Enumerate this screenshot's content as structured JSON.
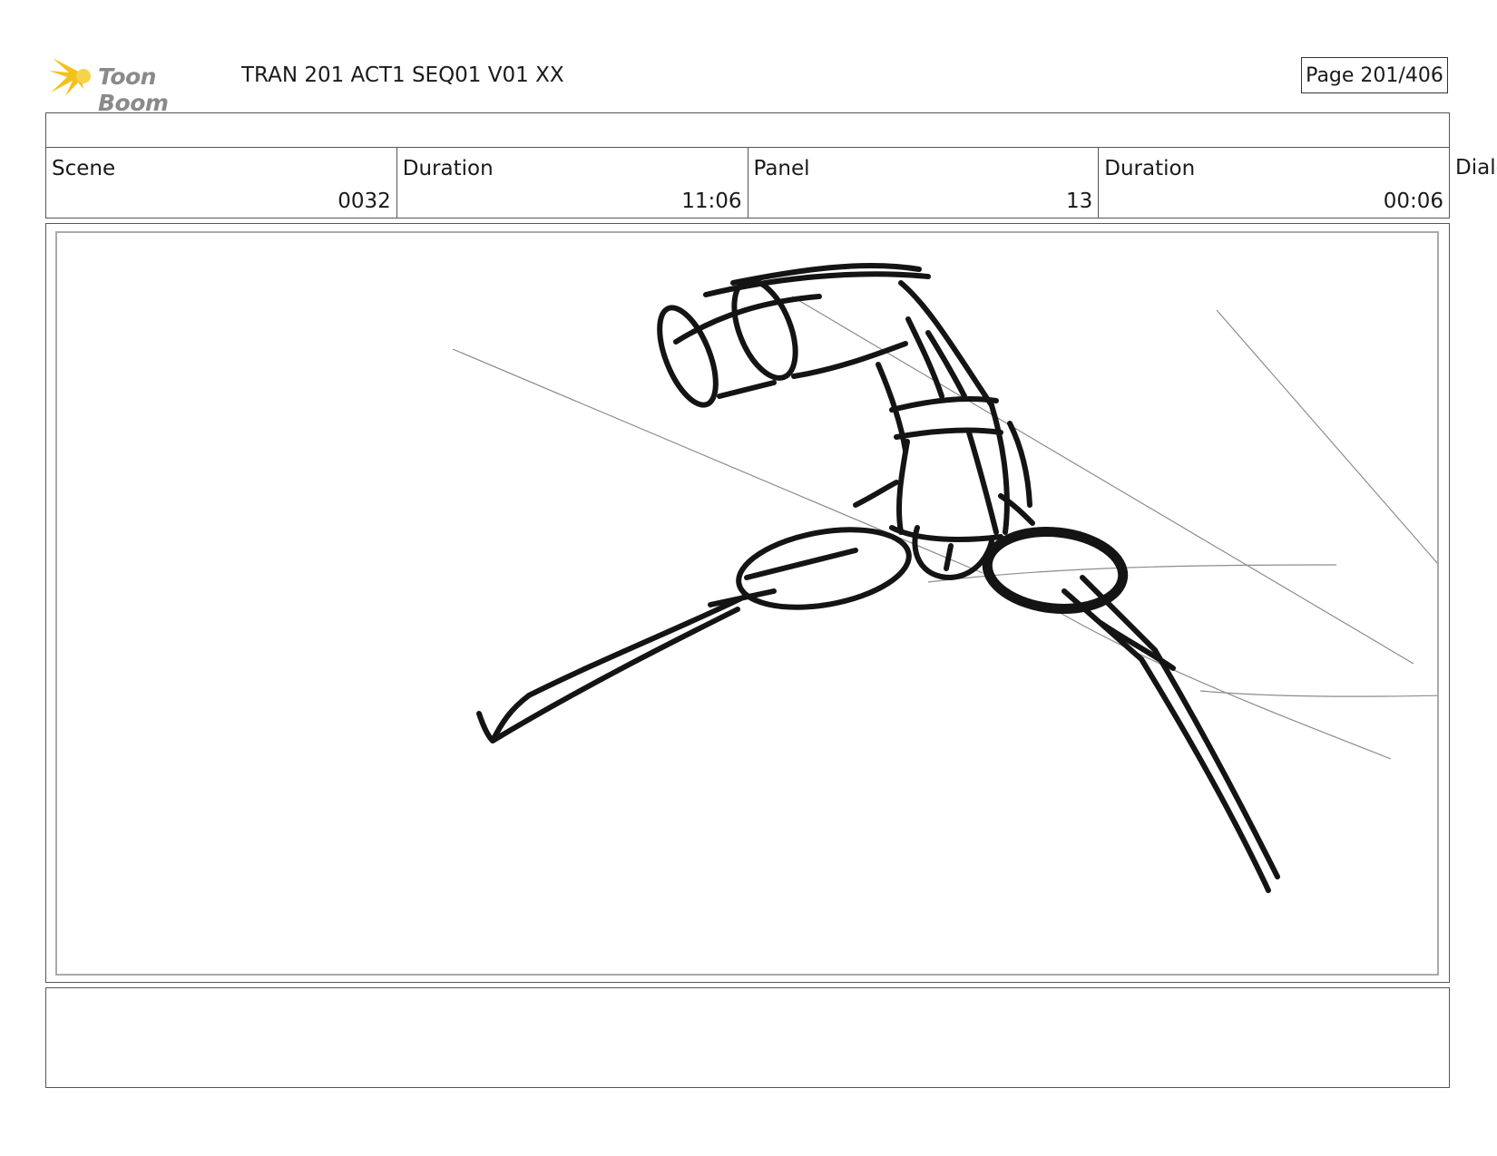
{
  "header": {
    "logo_text": "Toon Boom",
    "title": "TRAN 201 ACT1 SEQ01 V01 XX",
    "page": "Page 201/406"
  },
  "info": [
    {
      "label": "Scene",
      "value": "0032"
    },
    {
      "label": "Duration",
      "value": "11:06"
    },
    {
      "label": "Panel",
      "value": "13"
    },
    {
      "label": "Duration",
      "value": "00:06"
    }
  ],
  "dialog_label": "Dialo",
  "colors": {
    "logo_star": "#f2c21b",
    "sketch": "#141414",
    "guide": "#8c8c8c"
  }
}
